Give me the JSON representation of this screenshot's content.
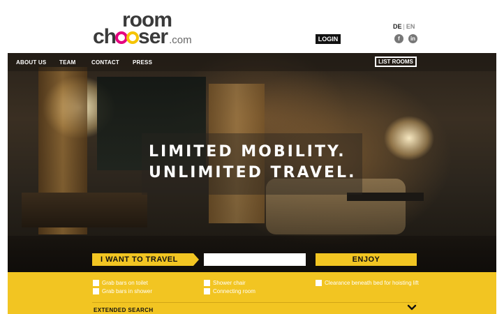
{
  "logo": {
    "line1": "room",
    "line2_prefix": "ch",
    "line2_suffix": "ser",
    "domain": ".com",
    "ring_colors": [
      "#e5007e",
      "#f5c400"
    ]
  },
  "header": {
    "login_label": "LOGIN",
    "lang_active": "DE",
    "lang_separator": "|",
    "lang_other": "EN",
    "social": [
      {
        "icon": "facebook-icon",
        "glyph": "f"
      },
      {
        "icon": "linkedin-icon",
        "glyph": "in"
      }
    ]
  },
  "nav": {
    "items": [
      "ABOUT US",
      "TEAM",
      "CONTACT",
      "PRESS"
    ],
    "list_rooms_label": "LIST ROOMS"
  },
  "hero": {
    "headline_line1": "LIMITED MOBILITY.",
    "headline_line2": "UNLIMITED TRAVEL."
  },
  "search": {
    "travel_label": "I WANT TO TRAVEL",
    "destination_value": "",
    "destination_placeholder": "",
    "enjoy_label": "ENJOY"
  },
  "filters": {
    "options": [
      {
        "label": "Grab bars on toilet",
        "checked": false
      },
      {
        "label": "Grab bars in shower",
        "checked": false
      },
      {
        "label": "Shower chair",
        "checked": false
      },
      {
        "label": "Connecting room",
        "checked": false
      },
      {
        "label": "Clearance beneath bed for hoisting lift",
        "checked": false
      }
    ],
    "extended_search_label": "EXTENDED SEARCH"
  },
  "colors": {
    "accent_yellow": "#f2c522",
    "dark": "#111111"
  }
}
